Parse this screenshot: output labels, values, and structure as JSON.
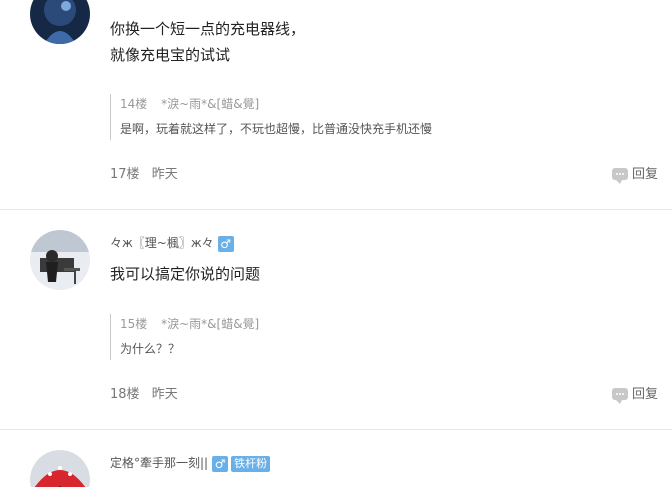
{
  "posts": [
    {
      "content_lines": [
        "你换一个短一点的充电器线，",
        "就像充电宝的试试"
      ],
      "quote": {
        "floor": "14楼",
        "user": "*淚~雨*&[蜡&覺]",
        "text": "是啊，玩着就这样了，不玩也超慢，比普通没快充手机还慢"
      },
      "floor": "17楼",
      "time": "昨天",
      "reply_label": "回复"
    },
    {
      "username": "々ж〖理~楓〗ж々",
      "gender": "♂",
      "content_lines": [
        "我可以搞定你说的问题"
      ],
      "quote": {
        "floor": "15楼",
        "user": "*淚~雨*&[蜡&覺]",
        "text": "为什么？？"
      },
      "floor": "18楼",
      "time": "昨天",
      "reply_label": "回复"
    },
    {
      "username": "定格°牽手那一刻||",
      "gender": "♂",
      "badge": "铁杆粉"
    }
  ],
  "colors": {
    "accent": "#6ab0e8",
    "divider": "#e6e6e6"
  }
}
